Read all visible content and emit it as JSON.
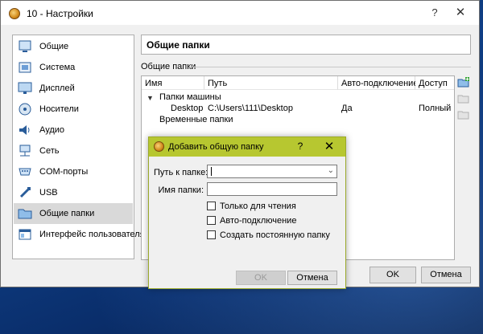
{
  "window": {
    "title": "10 - Настройки",
    "help_glyph": "?",
    "close_glyph": "✕"
  },
  "sidebar": {
    "items": [
      {
        "label": "Общие",
        "icon": "general-icon"
      },
      {
        "label": "Система",
        "icon": "system-icon"
      },
      {
        "label": "Дисплей",
        "icon": "display-icon"
      },
      {
        "label": "Носители",
        "icon": "storage-icon"
      },
      {
        "label": "Аудио",
        "icon": "audio-icon"
      },
      {
        "label": "Сеть",
        "icon": "network-icon"
      },
      {
        "label": "COM-порты",
        "icon": "serial-port-icon"
      },
      {
        "label": "USB",
        "icon": "usb-icon"
      },
      {
        "label": "Общие папки",
        "icon": "folder-icon"
      },
      {
        "label": "Интерфейс пользователя",
        "icon": "user-interface-icon"
      }
    ],
    "selected_index": 8
  },
  "panel": {
    "heading": "Общие папки",
    "group_label": "Общие папки"
  },
  "table": {
    "columns": [
      "Имя",
      "Путь",
      "Авто-подключение",
      "Доступ"
    ],
    "machine_folders_label": "Папки машины",
    "rows": [
      {
        "name": "Desktop",
        "path": "C:\\Users\\111\\Desktop",
        "auto": "Да",
        "access": "Полный"
      }
    ],
    "temporary_folders_label": "Временные папки"
  },
  "buttons": {
    "ok": "OK",
    "cancel": "Отмена"
  },
  "dialog": {
    "title": "Добавить общую папку",
    "help_glyph": "?",
    "close_glyph": "✕",
    "path_label": "Путь к папке:",
    "path_value": "",
    "name_label": "Имя папки:",
    "name_value": "",
    "checkboxes": [
      "Только для чтения",
      "Авто-подключение",
      "Создать постоянную папку"
    ],
    "ok": "OK",
    "cancel": "Отмена"
  },
  "colors": {
    "dialog_titlebar": "#b7c730",
    "selection": "#d9d9d9",
    "desktop": "#0f3f86"
  }
}
